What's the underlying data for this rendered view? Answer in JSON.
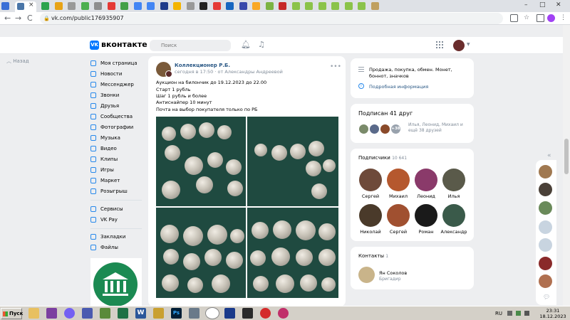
{
  "browser": {
    "tab_close": "×",
    "minimize": "–",
    "maximize": "□",
    "close": "✕",
    "url": "vk.com/public176935907",
    "nav": {
      "back": "←",
      "forward": "→",
      "reload": "C"
    }
  },
  "vk": {
    "brand": "вконтакте",
    "logo_text": "VK",
    "search_placeholder": "Поиск",
    "back_label": "Назад"
  },
  "nav": {
    "items": [
      "Моя страница",
      "Новости",
      "Мессенджер",
      "Звонки",
      "Друзья",
      "Сообщества",
      "Фотографии",
      "Музыка",
      "Видео",
      "Клипы",
      "Игры",
      "Маркет",
      "Розыгрыш"
    ],
    "secondary": [
      "Сервисы",
      "VK Pay"
    ],
    "tertiary": [
      "Закладки",
      "Файлы"
    ]
  },
  "post": {
    "author": "Коллекционер Р.Б.",
    "meta": "сегодня в 17:50 · от Александры Андреевой",
    "more": "•••",
    "lines": [
      "Аукцион на билончик до 19.12.2023 до 22.00",
      "Старт 1 рубль",
      "Шаг 1 рубль и более",
      "Антиснайпер 10 минут",
      "Почта на выбор покупателя только по РБ"
    ]
  },
  "info": {
    "description": "Продажа, покупка, обмен. Монет, боннот, значков",
    "link": "Подробная информация"
  },
  "friends": {
    "title": "Подписан 41 друг",
    "more_badge": "+38",
    "names": "Илья, Леонид, Михаил и ещё 38 друзей"
  },
  "subscribers": {
    "title": "Подписчики",
    "count": "10 641",
    "people": [
      "Сергей",
      "Михаил",
      "Леонид",
      "Илья",
      "Николай",
      "Сергей",
      "Роман",
      "Александр"
    ]
  },
  "contacts": {
    "title": "Контакты",
    "count": "1",
    "name": "Ян Соколов",
    "role": "Бригадир"
  },
  "taskbar": {
    "start": "Пуск",
    "lang": "RU",
    "time": "23:31",
    "date": "18.12.2023"
  },
  "colors": {
    "vk_blue": "#0077ff",
    "link": "#2a5885",
    "photo_bg": "#1f4a40",
    "taskbar": "#d4d0c8"
  }
}
